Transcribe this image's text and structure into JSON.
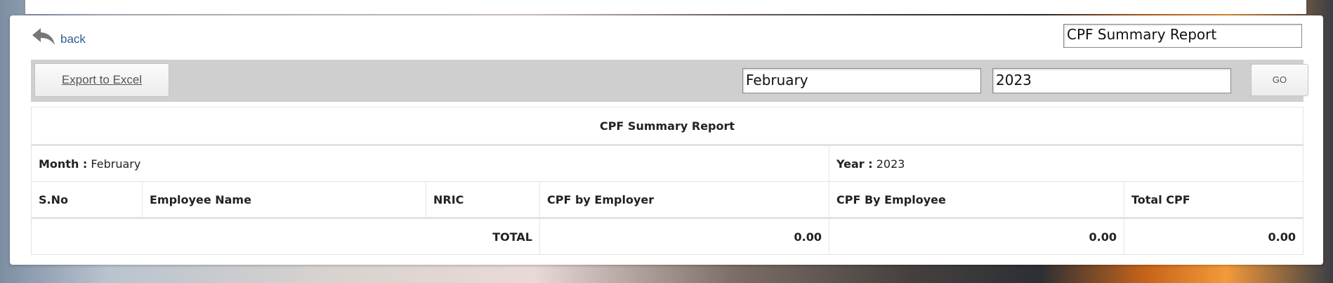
{
  "nav": {
    "back_label": "back"
  },
  "header": {
    "report_name": "CPF Summary Report"
  },
  "toolbar": {
    "export_label": "Export to Excel",
    "month_value": "February",
    "year_value": "2023",
    "go_label": "GO"
  },
  "report": {
    "title": "CPF Summary Report",
    "month_label": "Month :",
    "month_value": "February",
    "year_label": "Year :",
    "year_value": "2023",
    "columns": [
      "S.No",
      "Employee Name",
      "NRIC",
      "CPF by Employer",
      "CPF By Employee",
      "Total CPF"
    ],
    "total_label": "TOTAL",
    "total_employer": "0.00",
    "total_employee": "0.00",
    "total_cpf": "0.00"
  }
}
